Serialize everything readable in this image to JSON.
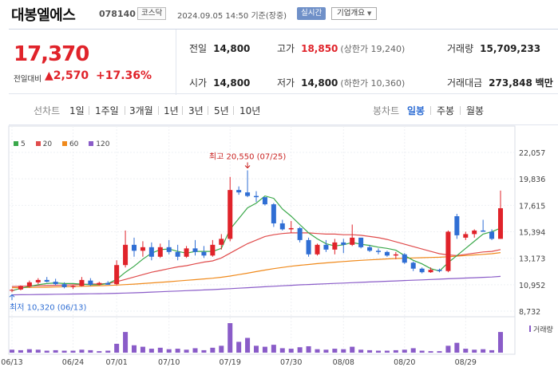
{
  "header": {
    "name": "대봉엘에스",
    "code": "078140",
    "market": "코스닥",
    "datetime": "2024.09.05 14:50",
    "basis": "기준(장중)",
    "live_label": "실시간",
    "info_label": "기업개요"
  },
  "price": {
    "current": "17,370",
    "change_label": "전일대비",
    "change": "2,570",
    "change_pct": "+17.36%",
    "prev_close_label": "전일",
    "prev_close": "14,800",
    "open_label": "시가",
    "open": "14,800",
    "high_label": "고가",
    "high": "18,850",
    "upper_limit": "(상한가 19,240)",
    "low_label": "저가",
    "low": "14,800",
    "lower_limit": "(하한가 10,360)",
    "volume_label": "거래량",
    "volume": "15,709,233",
    "amount_label": "거래대금",
    "amount": "273,848",
    "amount_unit": "백만"
  },
  "tabs": {
    "line_label": "선차트",
    "line_periods": [
      "1일",
      "1주일",
      "3개월",
      "1년",
      "3년",
      "5년",
      "10년"
    ],
    "candle_label": "봉차트",
    "candle_periods": [
      "일봉",
      "주봉",
      "월봉"
    ],
    "candle_selected": "일봉"
  },
  "colors": {
    "up": "#e0232a",
    "down": "#2f6ed4",
    "ma5": "#3aa84a",
    "ma20": "#e04c4c",
    "ma60": "#f08a1c",
    "ma120": "#8a5cc8",
    "volume": "#8a5cc8"
  },
  "chart_data": {
    "type": "candlestick",
    "legend": [
      "5",
      "20",
      "60",
      "120"
    ],
    "y_ticks": [
      22057,
      19836,
      17615,
      15394,
      13173,
      10952,
      8732
    ],
    "y_tick_labels": [
      "22,057",
      "19,836",
      "17,615",
      "15,394",
      "13,173",
      "10,952",
      "8,732"
    ],
    "ylim": [
      8732,
      22057
    ],
    "x_labels": [
      "06/13",
      "06/24",
      "07/01",
      "07/10",
      "07/19",
      "07/30",
      "08/08",
      "08/20",
      "08/29"
    ],
    "x_label_index": [
      0,
      7,
      12,
      18,
      25,
      32,
      38,
      45,
      52
    ],
    "max_annotation": "최고 20,550 (07/25)",
    "min_annotation": "최저 10,320 (06/13)",
    "volume_label": "거래량",
    "candles": [
      {
        "o": 10450,
        "h": 10600,
        "l": 10320,
        "c": 10520
      },
      {
        "o": 10550,
        "h": 10900,
        "l": 10480,
        "c": 10850
      },
      {
        "o": 10800,
        "h": 11300,
        "l": 10700,
        "c": 11150
      },
      {
        "o": 11150,
        "h": 11500,
        "l": 11000,
        "c": 11350
      },
      {
        "o": 11350,
        "h": 11600,
        "l": 11150,
        "c": 11200
      },
      {
        "o": 11200,
        "h": 11450,
        "l": 10900,
        "c": 11000
      },
      {
        "o": 11000,
        "h": 11150,
        "l": 10650,
        "c": 10750
      },
      {
        "o": 10750,
        "h": 10900,
        "l": 10600,
        "c": 10850
      },
      {
        "o": 10850,
        "h": 11600,
        "l": 10800,
        "c": 11350
      },
      {
        "o": 11300,
        "h": 11500,
        "l": 10850,
        "c": 10950
      },
      {
        "o": 10950,
        "h": 11200,
        "l": 10900,
        "c": 11100
      },
      {
        "o": 11100,
        "h": 11250,
        "l": 10950,
        "c": 10950
      },
      {
        "o": 11000,
        "h": 13000,
        "l": 10900,
        "c": 12600
      },
      {
        "o": 12600,
        "h": 15500,
        "l": 12400,
        "c": 14300
      },
      {
        "o": 14300,
        "h": 14900,
        "l": 13300,
        "c": 13800
      },
      {
        "o": 13800,
        "h": 14600,
        "l": 13300,
        "c": 14100
      },
      {
        "o": 14100,
        "h": 14500,
        "l": 13000,
        "c": 13300
      },
      {
        "o": 13300,
        "h": 14400,
        "l": 13200,
        "c": 14100
      },
      {
        "o": 14100,
        "h": 14700,
        "l": 13500,
        "c": 13700
      },
      {
        "o": 13700,
        "h": 14300,
        "l": 13000,
        "c": 13300
      },
      {
        "o": 13300,
        "h": 14200,
        "l": 13200,
        "c": 14000
      },
      {
        "o": 14000,
        "h": 14700,
        "l": 13400,
        "c": 13700
      },
      {
        "o": 13700,
        "h": 14200,
        "l": 13200,
        "c": 13400
      },
      {
        "o": 13400,
        "h": 14700,
        "l": 13300,
        "c": 14300
      },
      {
        "o": 14300,
        "h": 15200,
        "l": 13900,
        "c": 14800
      },
      {
        "o": 14800,
        "h": 20000,
        "l": 14600,
        "c": 18900
      },
      {
        "o": 18900,
        "h": 19200,
        "l": 18500,
        "c": 18700
      },
      {
        "o": 18700,
        "h": 20550,
        "l": 18300,
        "c": 18400
      },
      {
        "o": 18400,
        "h": 18800,
        "l": 17900,
        "c": 18300
      },
      {
        "o": 18300,
        "h": 18200,
        "l": 17600,
        "c": 17700
      },
      {
        "o": 17700,
        "h": 17800,
        "l": 15800,
        "c": 16100
      },
      {
        "o": 16100,
        "h": 16400,
        "l": 15500,
        "c": 15600
      },
      {
        "o": 15600,
        "h": 16300,
        "l": 15300,
        "c": 15700
      },
      {
        "o": 15700,
        "h": 15800,
        "l": 14500,
        "c": 14700
      },
      {
        "o": 14700,
        "h": 14900,
        "l": 13300,
        "c": 13500
      },
      {
        "o": 13500,
        "h": 14400,
        "l": 13400,
        "c": 14300
      },
      {
        "o": 14300,
        "h": 14700,
        "l": 13700,
        "c": 13900
      },
      {
        "o": 13900,
        "h": 14800,
        "l": 13500,
        "c": 14500
      },
      {
        "o": 14500,
        "h": 14800,
        "l": 13600,
        "c": 14300
      },
      {
        "o": 14300,
        "h": 16000,
        "l": 14200,
        "c": 14900
      },
      {
        "o": 14900,
        "h": 14900,
        "l": 14000,
        "c": 14100
      },
      {
        "o": 14100,
        "h": 14300,
        "l": 13700,
        "c": 13800
      },
      {
        "o": 13800,
        "h": 14000,
        "l": 13500,
        "c": 13700
      },
      {
        "o": 13700,
        "h": 13800,
        "l": 13300,
        "c": 13400
      },
      {
        "o": 13400,
        "h": 13700,
        "l": 13100,
        "c": 13500
      },
      {
        "o": 13500,
        "h": 13600,
        "l": 12700,
        "c": 12800
      },
      {
        "o": 12800,
        "h": 12900,
        "l": 12100,
        "c": 12300
      },
      {
        "o": 12300,
        "h": 12400,
        "l": 11900,
        "c": 12000
      },
      {
        "o": 12000,
        "h": 12400,
        "l": 11950,
        "c": 12200
      },
      {
        "o": 12200,
        "h": 12300,
        "l": 12000,
        "c": 12100
      },
      {
        "o": 12100,
        "h": 15500,
        "l": 12000,
        "c": 15400
      },
      {
        "o": 16700,
        "h": 16900,
        "l": 14800,
        "c": 15100
      },
      {
        "o": 14900,
        "h": 15400,
        "l": 14700,
        "c": 15200
      },
      {
        "o": 15200,
        "h": 15600,
        "l": 14900,
        "c": 15500
      },
      {
        "o": 15500,
        "h": 16400,
        "l": 15400,
        "c": 15400
      },
      {
        "o": 15400,
        "h": 15600,
        "l": 14700,
        "c": 14800
      },
      {
        "o": 14800,
        "h": 18850,
        "l": 14800,
        "c": 17370
      }
    ],
    "volumes": [
      6,
      5,
      7,
      6,
      4,
      5,
      4,
      4,
      6,
      5,
      3,
      4,
      18,
      42,
      15,
      12,
      8,
      10,
      7,
      8,
      6,
      9,
      5,
      10,
      14,
      60,
      22,
      30,
      14,
      12,
      16,
      9,
      8,
      11,
      13,
      7,
      6,
      8,
      7,
      12,
      6,
      5,
      4,
      4,
      5,
      6,
      9,
      4,
      3,
      3,
      14,
      20,
      8,
      6,
      7,
      5,
      42
    ],
    "ma5": [
      10450,
      10650,
      10800,
      10950,
      11050,
      11100,
      11050,
      11050,
      11000,
      10950,
      10950,
      11050,
      11400,
      12000,
      12500,
      13100,
      13600,
      13900,
      13950,
      13750,
      13600,
      13750,
      13750,
      13750,
      14000,
      15600,
      16500,
      17400,
      17800,
      18400,
      18200,
      17300,
      16700,
      16000,
      15300,
      14800,
      14400,
      14200,
      14300,
      14500,
      14350,
      14250,
      14100,
      14000,
      13850,
      13400,
      13000,
      12700,
      12300,
      12100,
      12800,
      13400,
      14000,
      14600,
      15200,
      15400,
      15700
    ],
    "ma20": [
      10800,
      10820,
      10840,
      10860,
      10880,
      10900,
      10920,
      10940,
      10970,
      11000,
      11020,
      11050,
      11200,
      11400,
      11600,
      11800,
      12000,
      12150,
      12300,
      12450,
      12550,
      12700,
      12850,
      12950,
      13200,
      13600,
      14000,
      14400,
      14700,
      15000,
      15150,
      15250,
      15300,
      15300,
      15300,
      15250,
      15200,
      15200,
      15150,
      15150,
      15100,
      15000,
      14900,
      14750,
      14550,
      14350,
      14150,
      13950,
      13750,
      13550,
      13450,
      13400,
      13500,
      13600,
      13700,
      13750,
      13900
    ],
    "ma60": [
      10700,
      10710,
      10720,
      10730,
      10740,
      10760,
      10780,
      10800,
      10820,
      10840,
      10860,
      10890,
      10920,
      10960,
      11000,
      11050,
      11100,
      11150,
      11200,
      11260,
      11320,
      11380,
      11440,
      11500,
      11580,
      11680,
      11800,
      11920,
      12050,
      12180,
      12300,
      12400,
      12500,
      12580,
      12650,
      12720,
      12780,
      12840,
      12900,
      12950,
      13000,
      13040,
      13080,
      13120,
      13150,
      13180,
      13200,
      13220,
      13240,
      13260,
      13300,
      13350,
      13400,
      13450,
      13500,
      13550,
      13650
    ],
    "ma120": [
      10100,
      10110,
      10120,
      10130,
      10140,
      10150,
      10160,
      10170,
      10180,
      10190,
      10200,
      10210,
      10230,
      10250,
      10270,
      10300,
      10330,
      10360,
      10390,
      10420,
      10450,
      10480,
      10510,
      10540,
      10580,
      10620,
      10660,
      10700,
      10740,
      10780,
      10820,
      10860,
      10900,
      10940,
      10970,
      11000,
      11030,
      11060,
      11090,
      11120,
      11150,
      11180,
      11210,
      11240,
      11270,
      11300,
      11330,
      11360,
      11390,
      11420,
      11450,
      11480,
      11510,
      11540,
      11570,
      11600,
      11650
    ]
  }
}
